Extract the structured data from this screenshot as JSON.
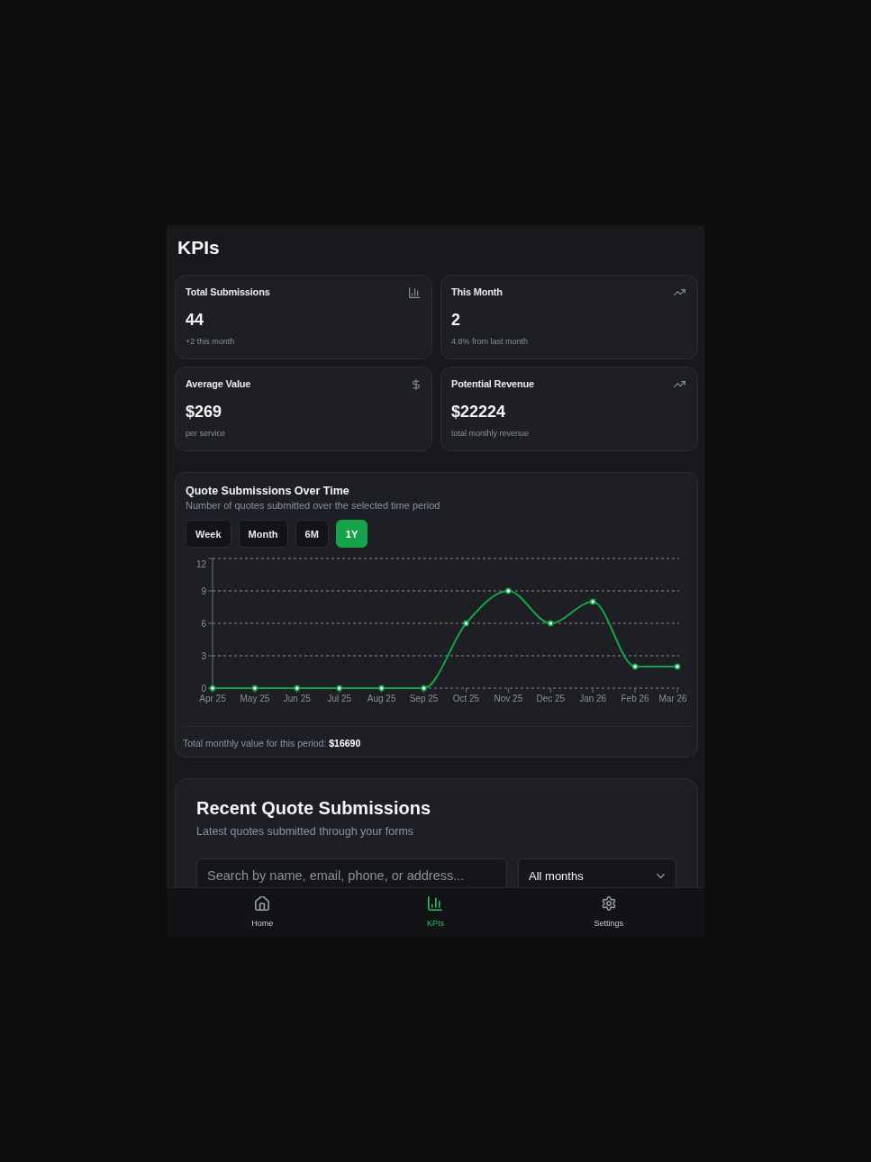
{
  "page": {
    "title": "KPIs"
  },
  "kpi_cards": [
    {
      "kind": "count",
      "title": "Total Submissions",
      "value": "44",
      "note": "+2 this month"
    },
    {
      "kind": "growth",
      "title": "This Month",
      "value": "2",
      "note": "4.8% from last month"
    },
    {
      "kind": "money",
      "title": "Average Value",
      "value": "$269",
      "note": "per service"
    },
    {
      "kind": "growth",
      "title": "Potential Revenue",
      "value": "$22224",
      "note": "total monthly revenue"
    }
  ],
  "chart_card": {
    "title": "Quote Submissions Over Time",
    "subtitle": "Number of quotes submitted over the selected time period",
    "ranges": [
      {
        "label": "Week",
        "selected": false
      },
      {
        "label": "Month",
        "selected": false
      },
      {
        "label": "6M",
        "selected": false
      },
      {
        "label": "1Y",
        "selected": true
      }
    ],
    "chart_data": {
      "type": "line",
      "grid": true,
      "categories": [
        "Apr 25",
        "May 25",
        "Jun 25",
        "Jul 25",
        "Aug 25",
        "Sep 25",
        "Oct 25",
        "Nov 25",
        "Dec 25",
        "Jan 26",
        "Feb 26",
        "Mar 26"
      ],
      "series": [
        {
          "color": "#16a34a",
          "marker": "circle",
          "values": [
            0,
            0,
            0,
            0,
            0,
            0,
            6,
            9,
            6,
            8,
            2,
            2
          ]
        }
      ],
      "ylim": [
        0,
        12
      ],
      "yticks": [
        0,
        3,
        6,
        9,
        12
      ]
    },
    "total": "Total monthly value for this period: **$16690**"
  },
  "recent": {
    "title": "Recent Quote Submissions",
    "subtitle": "Latest quotes submitted through your forms",
    "search": {
      "placeholder": "Search by name, email, phone, or address..."
    },
    "month_filter": {
      "value": "All months"
    }
  },
  "nav": {
    "items": [
      {
        "kind": "home",
        "label": "Home",
        "selected": false
      },
      {
        "kind": "kpis",
        "label": "KPIs",
        "selected": true
      },
      {
        "kind": "settings",
        "label": "Settings",
        "selected": false
      }
    ]
  }
}
